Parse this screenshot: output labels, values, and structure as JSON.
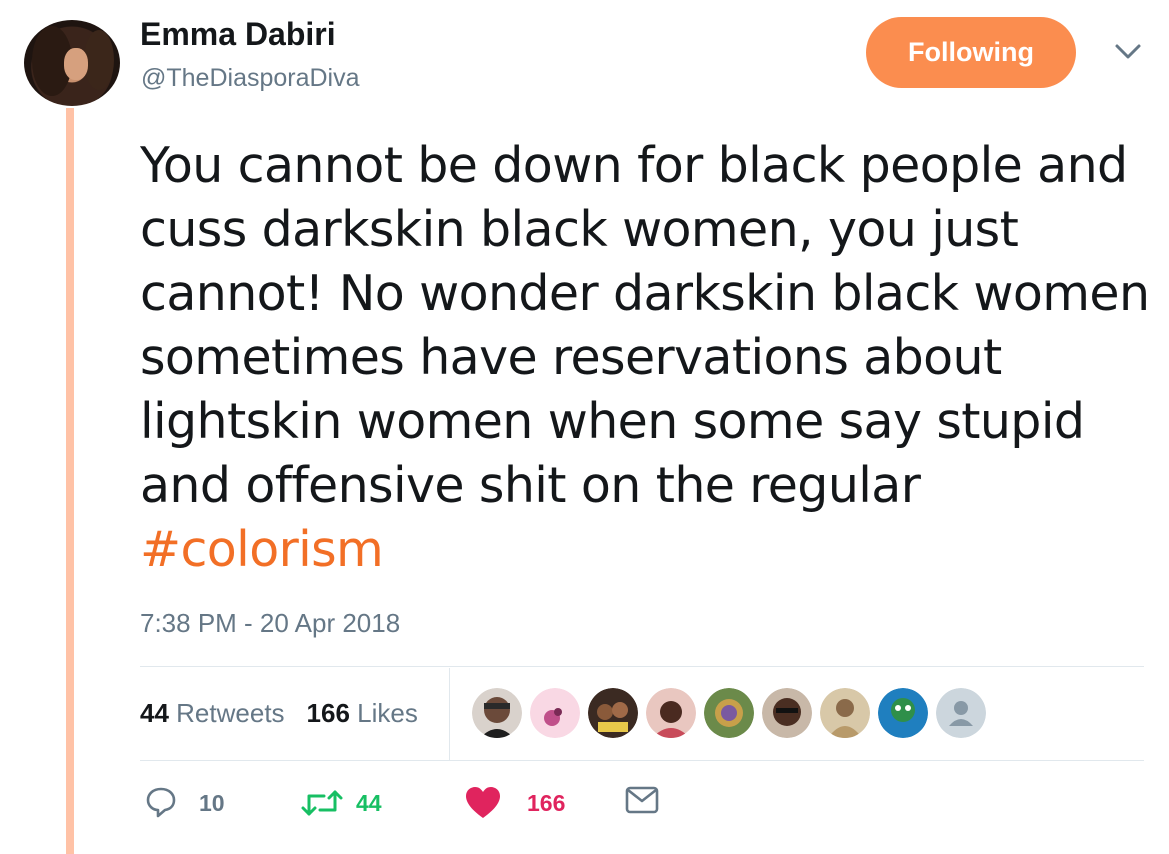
{
  "author": {
    "name": "Emma Dabiri",
    "handle": "@TheDiasporaDiva",
    "avatar_icon": "profile-photo"
  },
  "follow_button": {
    "label": "Following",
    "color": "#fb8d4f"
  },
  "menu": {
    "icon": "chevron-down-icon"
  },
  "tweet": {
    "text": "You cannot be down for black people and cuss darkskin black women, you just cannot! No wonder darkskin black women sometimes have reservations about lightskin women when some say stupid and offensive shit on the regular",
    "hashtag": "#colorism",
    "hashtag_color": "#f26f26",
    "timestamp": "7:38 PM - 20 Apr 2018"
  },
  "stats": {
    "retweets_count": "44",
    "retweets_label": "Retweets",
    "likes_count": "166",
    "likes_label": "Likes"
  },
  "likers": [
    {
      "icon": "liker-avatar-1",
      "color": "#6b4a3a"
    },
    {
      "icon": "liker-avatar-2",
      "color": "#f4c6d6"
    },
    {
      "icon": "liker-avatar-3",
      "color": "#5a3b2a"
    },
    {
      "icon": "liker-avatar-4",
      "color": "#c84b5a"
    },
    {
      "icon": "liker-avatar-5",
      "color": "#7a8c3a"
    },
    {
      "icon": "liker-avatar-6",
      "color": "#4a2e22"
    },
    {
      "icon": "liker-avatar-7",
      "color": "#b89a6a"
    },
    {
      "icon": "liker-avatar-8",
      "color": "#2f8f4a"
    },
    {
      "icon": "default-avatar-icon",
      "color": "#ccd6dd"
    }
  ],
  "actions": {
    "reply_count": "10",
    "retweet_count": "44",
    "like_count": "166",
    "reply_color": "#657786",
    "retweet_color": "#17bf63",
    "like_color": "#e0245e"
  }
}
